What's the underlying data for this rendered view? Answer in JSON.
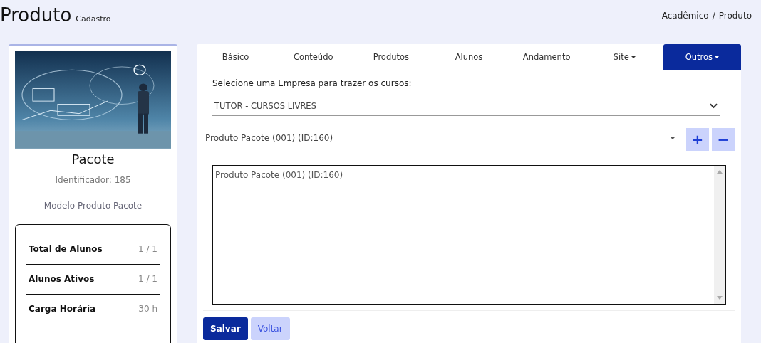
{
  "header": {
    "title": "Produto",
    "subtitle": "Cadastro"
  },
  "breadcrumb": [
    "Acadêmico",
    "/",
    "Produto"
  ],
  "product": {
    "name": "Pacote",
    "identifier": "Identificador: 185",
    "model": "Modelo Produto Pacote",
    "stats": [
      {
        "label": "Total de Alunos",
        "value": "1 / 1"
      },
      {
        "label": "Alunos Ativos",
        "value": "1 / 1"
      },
      {
        "label": "Carga Horária",
        "value": "30 h"
      }
    ]
  },
  "tabs": [
    {
      "label": "Básico",
      "selected": false,
      "dropdown": false
    },
    {
      "label": "Conteúdo",
      "selected": false,
      "dropdown": false
    },
    {
      "label": "Produtos",
      "selected": false,
      "dropdown": false
    },
    {
      "label": "Alunos",
      "selected": false,
      "dropdown": false
    },
    {
      "label": "Andamento",
      "selected": false,
      "dropdown": false
    },
    {
      "label": "Site",
      "selected": false,
      "dropdown": true
    },
    {
      "label": "Outros",
      "selected": true,
      "dropdown": true
    }
  ],
  "company_label": "Selecione uma Empresa para trazer os cursos:",
  "company_select": {
    "value": "TUTOR - CURSOS LIVRES"
  },
  "product_select": {
    "value": "Produto Pacote (001) (ID:160)"
  },
  "add_button": "+",
  "remove_button": "−",
  "product_list": [
    "Produto Pacote (001) (ID:160)"
  ],
  "buttons": [
    {
      "label": "Salvar",
      "kind": "primary"
    },
    {
      "label": "Voltar",
      "kind": "secondary"
    }
  ]
}
